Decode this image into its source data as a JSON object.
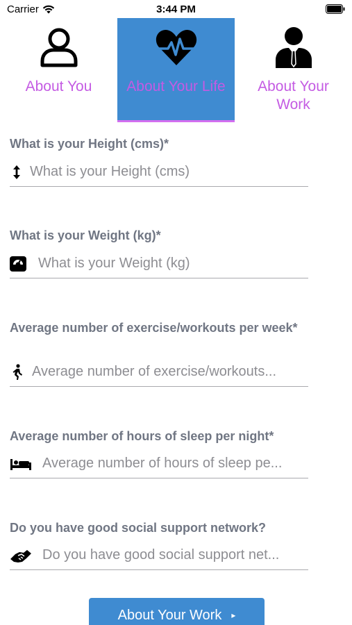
{
  "status_bar": {
    "carrier": "Carrier",
    "time": "3:44 PM"
  },
  "tabs": [
    {
      "label": "About You",
      "icon": "user-outline-icon",
      "selected": false
    },
    {
      "label": "About Your Life",
      "icon": "heartbeat-icon",
      "selected": true
    },
    {
      "label": "About Your Work",
      "icon": "businessman-icon",
      "selected": false
    }
  ],
  "fields": [
    {
      "label": "What is your Height (cms)*",
      "placeholder": "What is your Height (cms)",
      "value": "",
      "icon": "vertical-arrows-icon"
    },
    {
      "label": "What is your Weight (kg)*",
      "placeholder": "What is your Weight (kg)",
      "value": "",
      "icon": "weight-scale-icon"
    },
    {
      "label": "Average number of exercise/workouts per week*",
      "placeholder": "Average number of exercise/workouts...",
      "value": "",
      "icon": "walking-person-icon"
    },
    {
      "label": "Average number of hours of sleep per night*",
      "placeholder": "Average number of hours of sleep pe...",
      "value": "",
      "icon": "bed-icon"
    },
    {
      "label": "Do you have good social support network?",
      "placeholder": "Do you have good social support net...",
      "value": "",
      "icon": "handshake-icon"
    }
  ],
  "next_button": {
    "label": "About Your Work",
    "icon": "chevron-right-icon"
  },
  "colors": {
    "accent": "#3f8bd1",
    "tab_label": "#c45be3",
    "tab_underline": "#d36ff0",
    "field_label": "#707683",
    "placeholder": "#8d8d92"
  }
}
